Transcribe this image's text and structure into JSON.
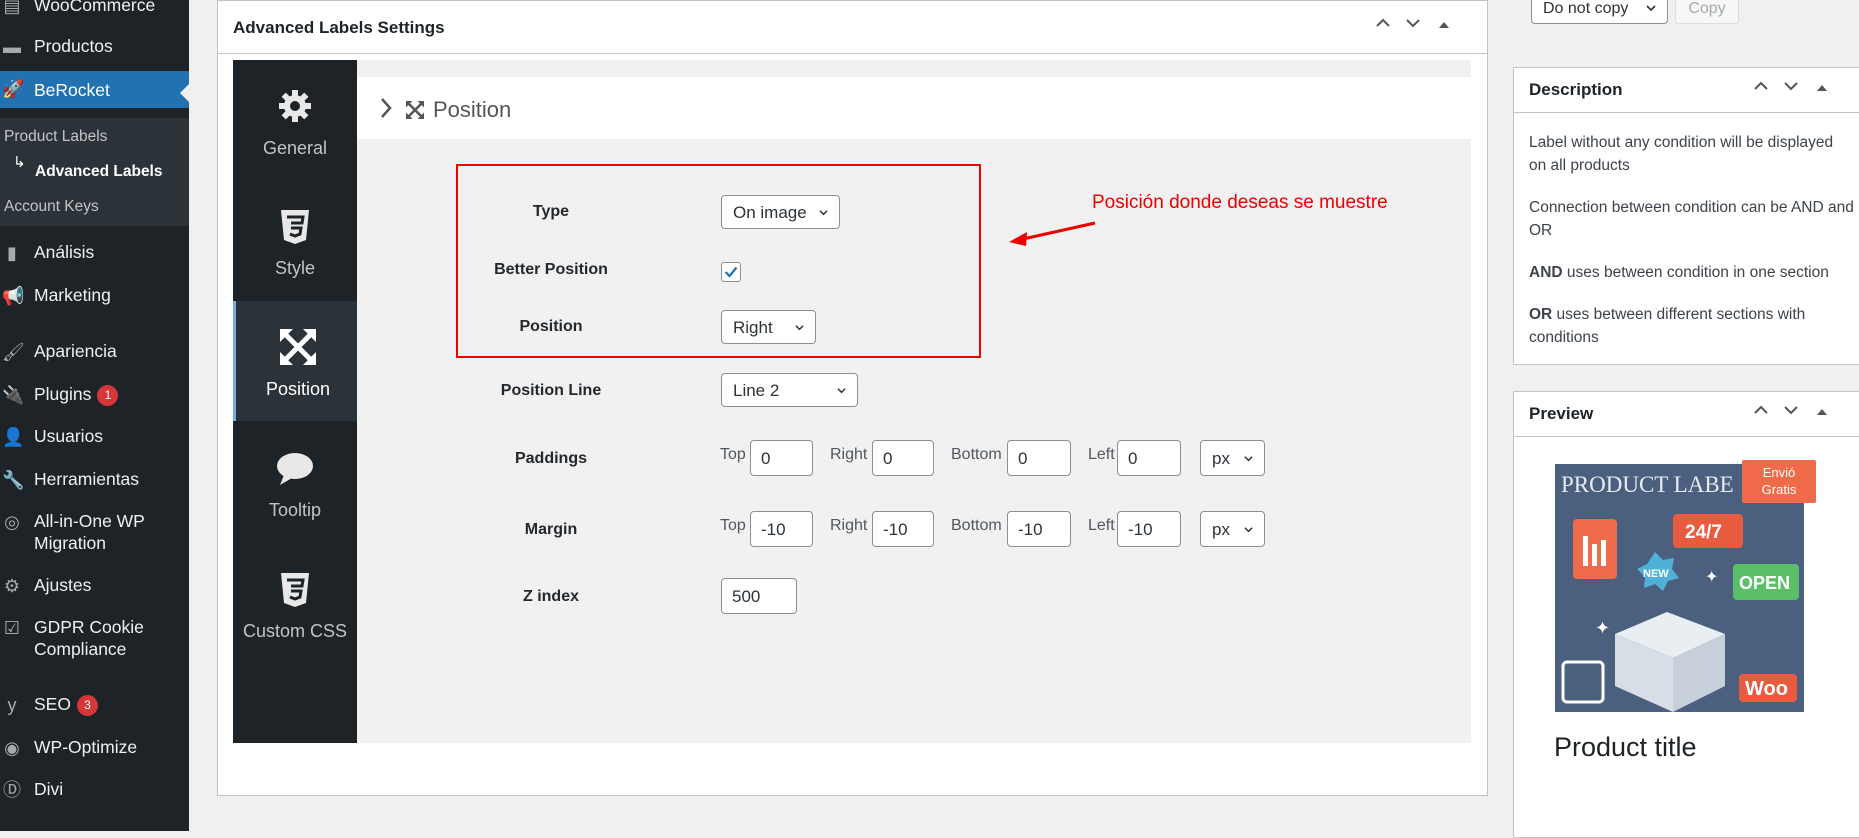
{
  "sidebar": {
    "top_item": "WooCommerce",
    "productos": "Productos",
    "berocket": "BeRocket",
    "submenu": [
      "Product Labels",
      "Advanced Labels",
      "Account Keys"
    ],
    "analisis": "Análisis",
    "marketing": "Marketing",
    "apariencia": "Apariencia",
    "plugins": "Plugins",
    "plugins_badge": "1",
    "usuarios": "Usuarios",
    "herramientas": "Herramientas",
    "migration_line1": "All-in-One WP",
    "migration_line2": "Migration",
    "ajustes": "Ajustes",
    "gdpr_line1": "GDPR Cookie",
    "gdpr_line2": "Compliance",
    "seo": "SEO",
    "seo_badge": "3",
    "wpoptimize": "WP-Optimize",
    "divi": "Divi"
  },
  "main": {
    "title": "Advanced Labels Settings",
    "tabs": [
      "General",
      "Style",
      "Position",
      "Tooltip",
      "Custom CSS"
    ],
    "active_tab": "Position",
    "section_title": "Position",
    "fields": {
      "type_label": "Type",
      "type_value": "On image",
      "better_position_label": "Better Position",
      "better_position_checked": true,
      "position_label": "Position",
      "position_value": "Right",
      "position_line_label": "Position Line",
      "position_line_value": "Line 2",
      "paddings_label": "Paddings",
      "paddings": {
        "top_label": "Top",
        "top": "0",
        "right_label": "Right",
        "right": "0",
        "bottom_label": "Bottom",
        "bottom": "0",
        "left_label": "Left",
        "left": "0",
        "unit": "px"
      },
      "margin_label": "Margin",
      "margin": {
        "top_label": "Top",
        "top": "-10",
        "right_label": "Right",
        "right": "-10",
        "bottom_label": "Bottom",
        "bottom": "-10",
        "left_label": "Left",
        "left": "-10",
        "unit": "px"
      },
      "zindex_label": "Z index",
      "zindex_value": "500"
    },
    "annotation": "Posición donde deseas se muestre"
  },
  "right": {
    "copy_select": "Do not copy",
    "copy_button": "Copy",
    "description_title": "Description",
    "description": {
      "p1": "Label without any condition will be displayed on all products",
      "p2": "Connection between condition can be AND and OR",
      "p3_bold": "AND",
      "p3_rest": " uses between condition in one section",
      "p4_bold": "OR",
      "p4_rest": " uses between different sections with conditions"
    },
    "preview_title": "Preview",
    "sale_badge_line1": "Envió",
    "sale_badge_line2": "Gratis",
    "image_text": {
      "banner": "PRODUCT LABE",
      "tag_247": "24/7",
      "tag_new": "NEW",
      "tag_open": "OPEN",
      "tag_woo": "Woo"
    },
    "product_title": "Product title"
  },
  "colors": {
    "sidebar_bg": "#1d2327",
    "active_blue": "#2271b1",
    "annotation_red": "#ee0000",
    "badge_red": "#d63638"
  }
}
